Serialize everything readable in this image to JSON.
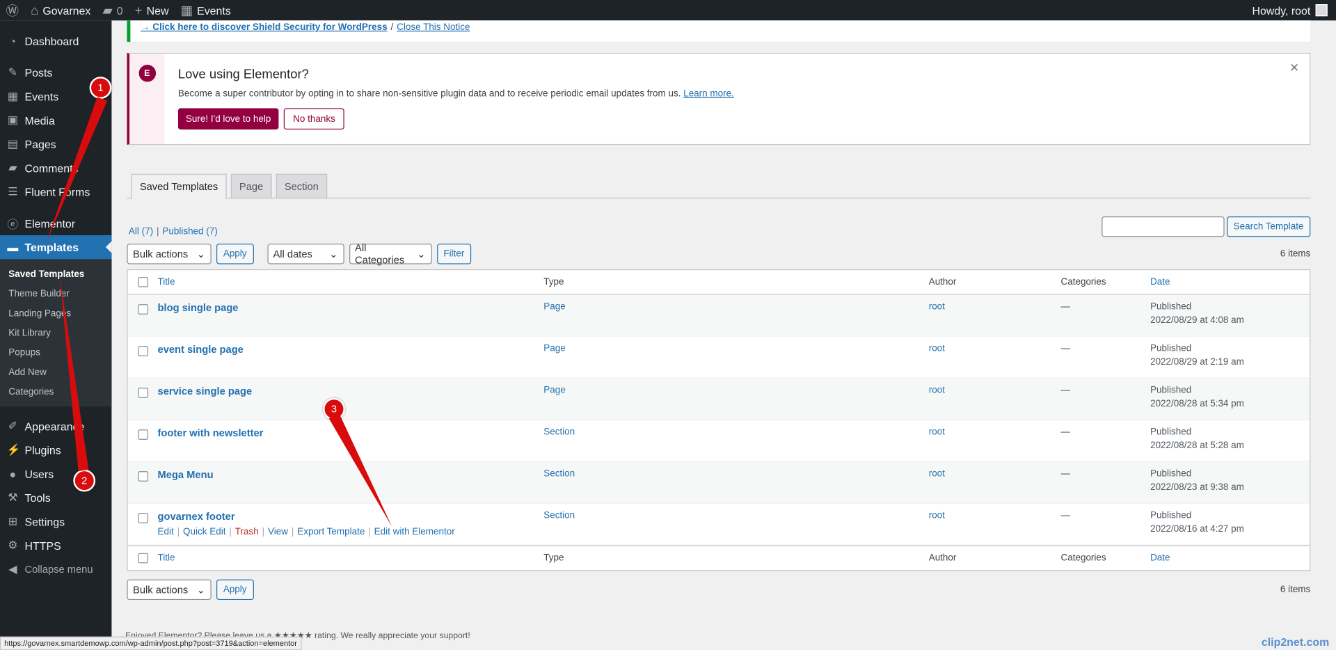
{
  "adminbar": {
    "site_name": "Govarnex",
    "comments_count": "0",
    "new_label": "New",
    "events_label": "Events",
    "howdy": "Howdy, root"
  },
  "sidebar": {
    "items": [
      {
        "label": "Dashboard",
        "icon": "dashboard-icon"
      },
      {
        "label": "Posts",
        "icon": "pin-icon"
      },
      {
        "label": "Events",
        "icon": "calendar-icon"
      },
      {
        "label": "Media",
        "icon": "media-icon"
      },
      {
        "label": "Pages",
        "icon": "page-icon"
      },
      {
        "label": "Comments",
        "icon": "comment-icon"
      },
      {
        "label": "Fluent Forms",
        "icon": "form-icon"
      },
      {
        "label": "Elementor",
        "icon": "elementor-icon"
      },
      {
        "label": "Templates",
        "icon": "folder-icon"
      },
      {
        "label": "Appearance",
        "icon": "brush-icon"
      },
      {
        "label": "Plugins",
        "icon": "plug-icon"
      },
      {
        "label": "Users",
        "icon": "user-icon"
      },
      {
        "label": "Tools",
        "icon": "wrench-icon"
      },
      {
        "label": "Settings",
        "icon": "settings-icon"
      },
      {
        "label": "HTTPS",
        "icon": "gear-icon"
      },
      {
        "label": "Collapse menu",
        "icon": "collapse-icon"
      }
    ],
    "submenu": [
      "Saved Templates",
      "Theme Builder",
      "Landing Pages",
      "Kit Library",
      "Popups",
      "Add New",
      "Categories"
    ]
  },
  "shield_notice": {
    "link": "→ Click here to discover Shield Security for WordPress",
    "sep": "/",
    "close": "Close This Notice"
  },
  "elementor_notice": {
    "title": "Love using Elementor?",
    "desc": "Become a super contributor by opting in to share non-sensitive plugin data and to receive periodic email updates from us.",
    "learn_more": "Learn more.",
    "yes": "Sure! I'd love to help",
    "no": "No thanks"
  },
  "tabs": [
    "Saved Templates",
    "Page",
    "Section"
  ],
  "filters": {
    "all": "All (7)",
    "sep": "|",
    "published": "Published (7)",
    "search_button": "Search Template",
    "bulk": "Bulk actions",
    "apply": "Apply",
    "dates": "All dates",
    "categories": "All Categories",
    "filter": "Filter",
    "count": "6 items"
  },
  "table": {
    "headers": {
      "title": "Title",
      "type": "Type",
      "author": "Author",
      "categories": "Categories",
      "date": "Date"
    },
    "rows": [
      {
        "title": "blog single page",
        "type": "Page",
        "author": "root",
        "categories": "—",
        "status": "Published",
        "date": "2022/08/29 at 4:08 am"
      },
      {
        "title": "event single page",
        "type": "Page",
        "author": "root",
        "categories": "—",
        "status": "Published",
        "date": "2022/08/29 at 2:19 am"
      },
      {
        "title": "service single page",
        "type": "Page",
        "author": "root",
        "categories": "—",
        "status": "Published",
        "date": "2022/08/28 at 5:34 pm"
      },
      {
        "title": "footer with newsletter",
        "type": "Section",
        "author": "root",
        "categories": "—",
        "status": "Published",
        "date": "2022/08/28 at 5:28 am"
      },
      {
        "title": "Mega Menu",
        "type": "Section",
        "author": "root",
        "categories": "—",
        "status": "Published",
        "date": "2022/08/23 at 9:38 am"
      },
      {
        "title": "govarnex footer",
        "type": "Section",
        "author": "root",
        "categories": "—",
        "status": "Published",
        "date": "2022/08/16 at 4:27 pm"
      }
    ],
    "row_actions": {
      "edit": "Edit",
      "quick_edit": "Quick Edit",
      "trash": "Trash",
      "view": "View",
      "export": "Export Template",
      "edit_elementor": "Edit with Elementor",
      "sep": "|"
    }
  },
  "annotations": [
    "1",
    "2",
    "3"
  ],
  "footer": {
    "text": "Enjoyed Elementor? Please leave us a ★★★★★ rating. We really appreciate your support!"
  },
  "statusbar": "https://govarnex.smartdemowp.com/wp-admin/post.php?post=3719&action=elementor",
  "watermark": "clip2net.com",
  "colors": {
    "accent": "#2271b1",
    "elementor": "#93003f",
    "annotation": "#d80c0c"
  }
}
